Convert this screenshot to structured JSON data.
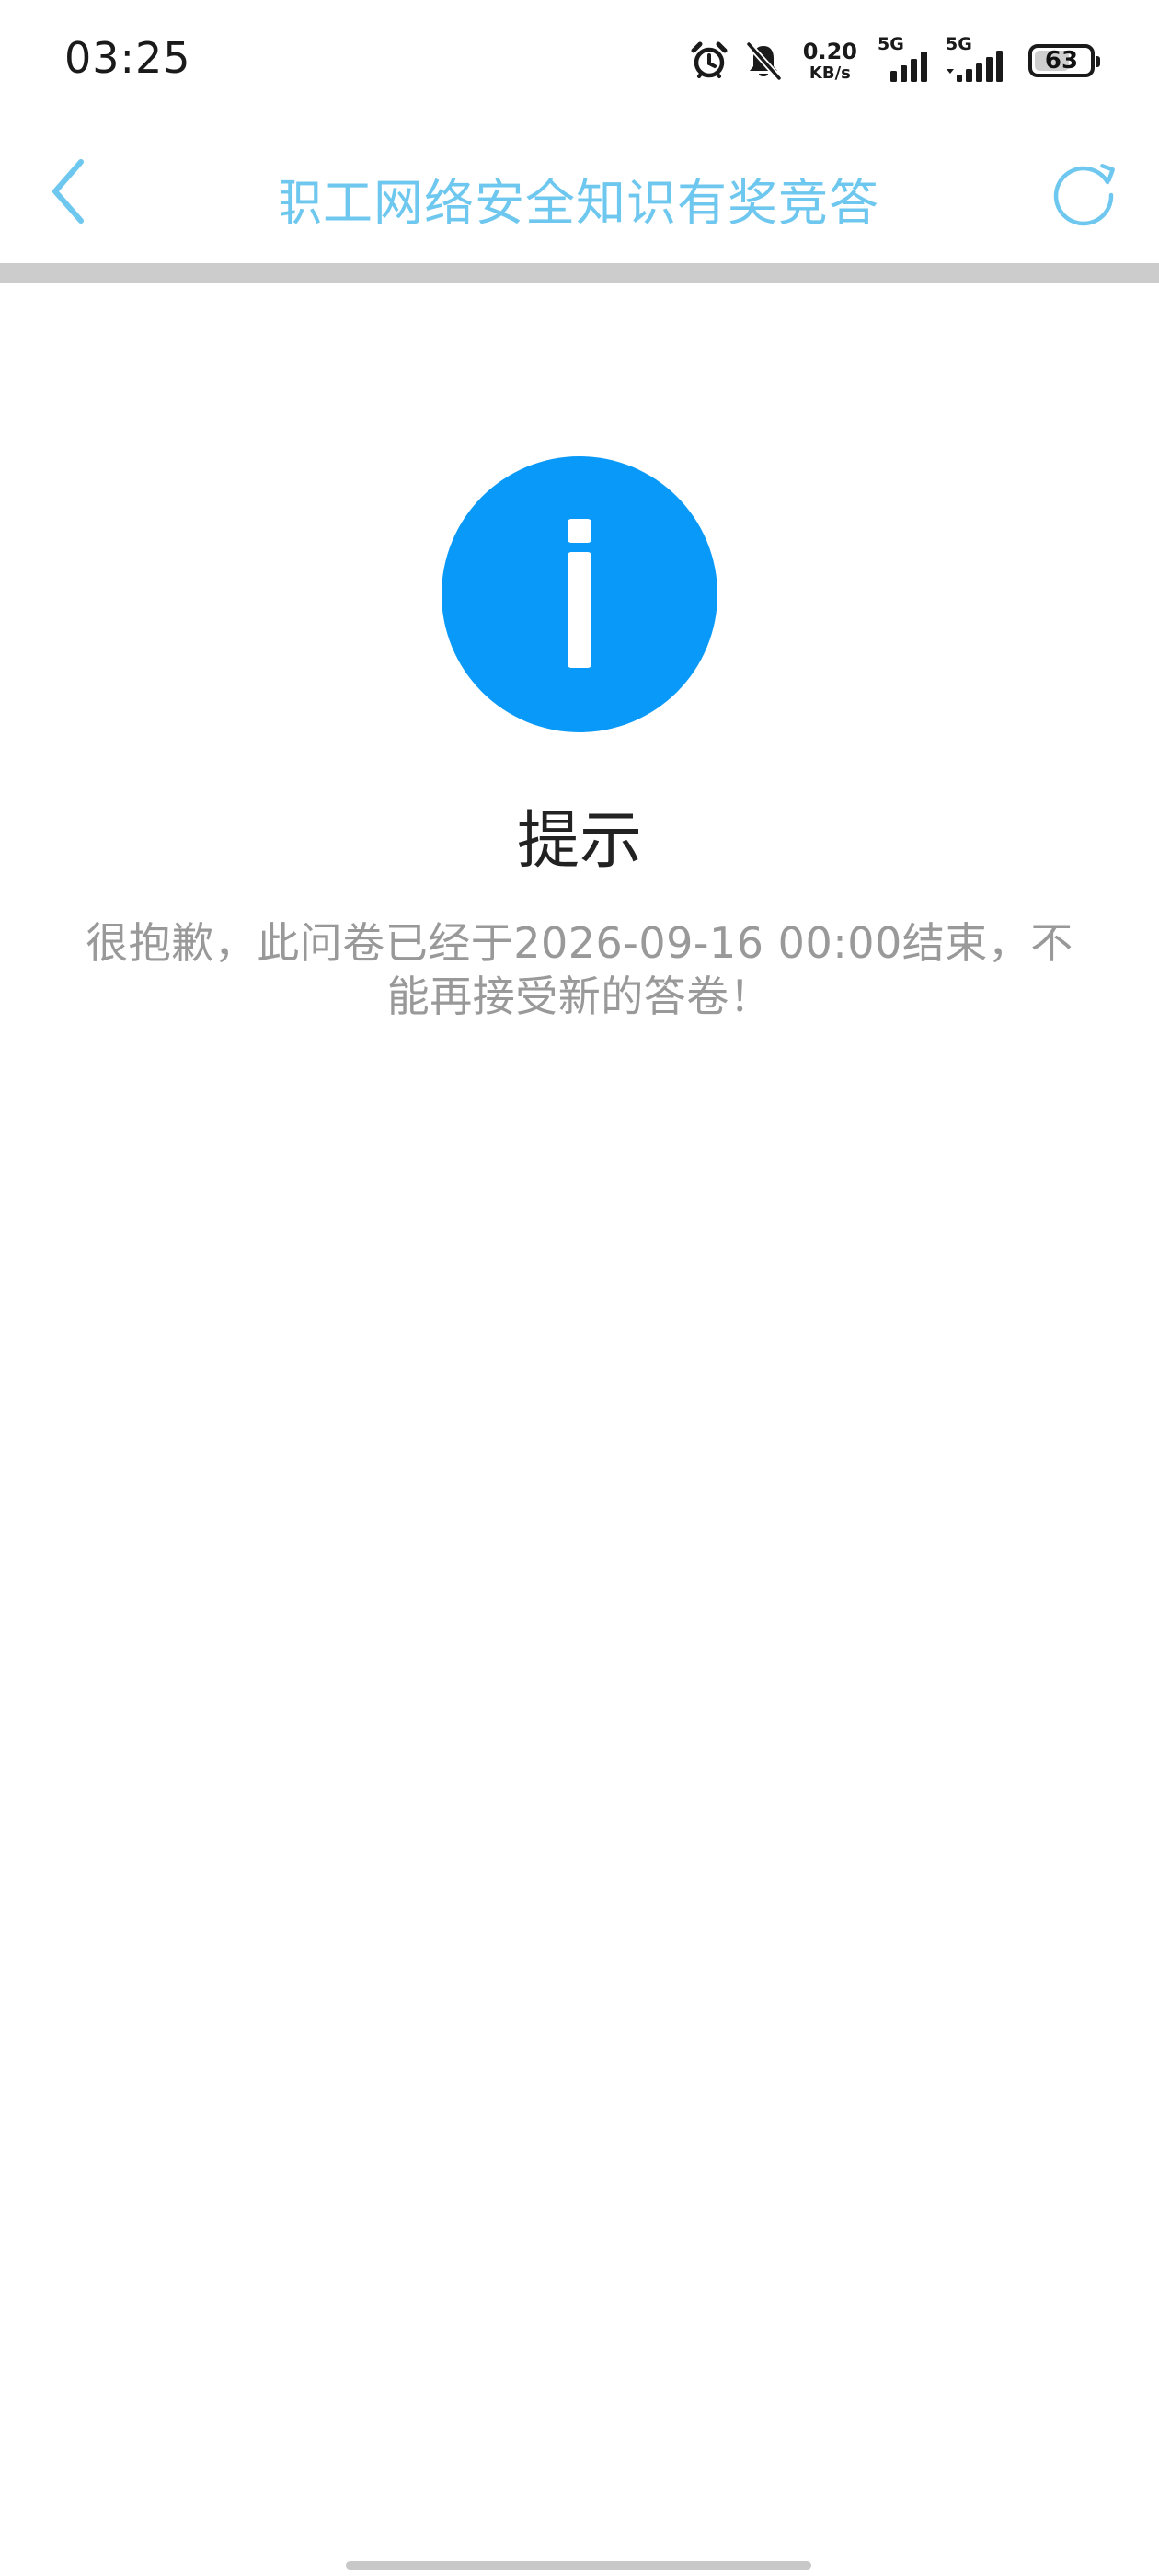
{
  "status_bar": {
    "time": "03:25",
    "net_speed_value": "0.20",
    "net_speed_unit": "KB/s",
    "sim1_label": "5G",
    "sim2_label": "5G",
    "battery_level": "63",
    "battery_fraction": 0.63,
    "icons": [
      "alarm-icon",
      "bell-muted-icon",
      "signal-icon",
      "signal-icon",
      "battery-icon"
    ]
  },
  "nav": {
    "title": "职工网络安全知识有奖竞答",
    "back_icon": "chevron-left-icon",
    "refresh_icon": "refresh-icon",
    "accent_color": "#6ec7ee"
  },
  "notice": {
    "icon": "info-icon",
    "icon_color": "#0999f8",
    "title": "提示",
    "message": "很抱歉，此问卷已经于2026-09-16 00:00结束，不能再接受新的答卷！"
  }
}
